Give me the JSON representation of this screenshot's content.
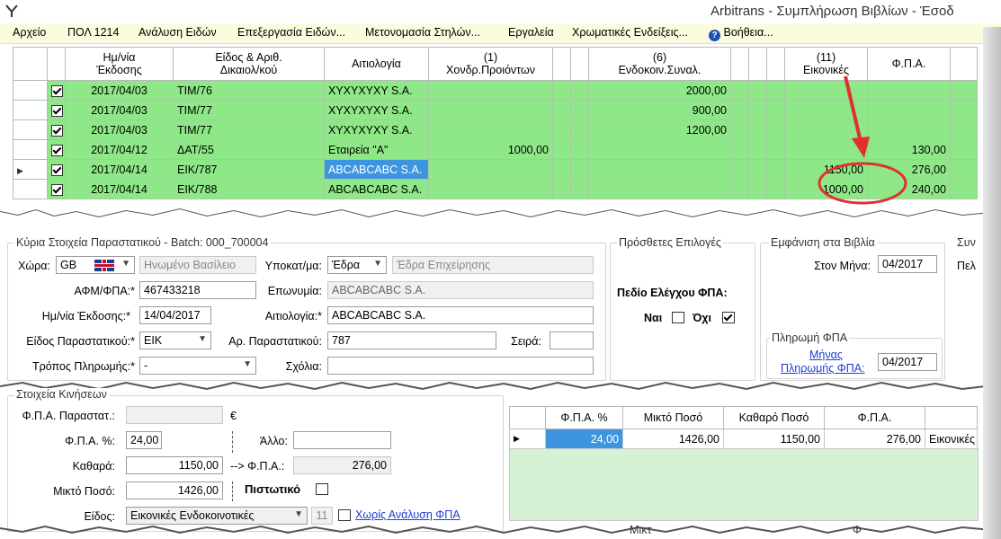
{
  "title": "Arbitrans - Συμπλήρωση Βιβλίων - Έσοδ",
  "menu": [
    "Αρχείο",
    "ΠΟΛ 1214",
    "Ανάλυση Ειδών",
    "Επεξεργασία Ειδών...",
    "Μετονομασία Στηλών...",
    "Εργαλεία",
    "Χρωματικές Ενδείξεις...",
    "Βοήθεια..."
  ],
  "grid": {
    "headers": {
      "date_1": "Ημ/νία",
      "date_2": "Έκδοσης",
      "doc_1": "Είδος & Αριθ.",
      "doc_2": "Δικαιολ/κού",
      "reason": "Αιτιολογία",
      "c1_1": "(1)",
      "c1_2": "Χονδρ.Προιόντων",
      "c6_1": "(6)",
      "c6_2": "Ενδοκοιν.Συναλ.",
      "c11_1": "(11)",
      "c11_2": "Εικονικές",
      "vat": "Φ.Π.Α."
    },
    "rows": [
      {
        "checked": true,
        "date": "2017/04/03",
        "doc": "ΤΙΜ/76",
        "reason": "ΧΥΧΥΧΥΧΥ S.A.",
        "c1": "",
        "c6": "2000,00",
        "c11": "",
        "vat": "",
        "current": false
      },
      {
        "checked": true,
        "date": "2017/04/03",
        "doc": "ΤΙΜ/77",
        "reason": "ΧΥΧΥΧΥΧΥ S.A.",
        "c1": "",
        "c6": "900,00",
        "c11": "",
        "vat": "",
        "current": false
      },
      {
        "checked": true,
        "date": "2017/04/03",
        "doc": "ΤΙΜ/77",
        "reason": "ΧΥΧΥΧΥΧΥ S.A.",
        "c1": "",
        "c6": "1200,00",
        "c11": "",
        "vat": "",
        "current": false
      },
      {
        "checked": true,
        "date": "2017/04/12",
        "doc": "ΔΑΤ/55",
        "reason": "Εταιρεία \"Α\"",
        "c1": "1000,00",
        "c6": "",
        "c11": "",
        "vat": "130,00",
        "current": false
      },
      {
        "checked": true,
        "date": "2017/04/14",
        "doc": "ΕΙΚ/787",
        "reason": "ABCABCABC S.A.",
        "c1": "",
        "c6": "",
        "c11": "1150,00",
        "vat": "276,00",
        "current": true
      },
      {
        "checked": true,
        "date": "2017/04/14",
        "doc": "ΕΙΚ/788",
        "reason": "ABCABCABC S.A.",
        "c1": "",
        "c6": "",
        "c11": "1000,00",
        "vat": "240,00",
        "current": false
      }
    ]
  },
  "main_section": {
    "title": "Κύρια Στοιχεία Παραστατικού - Batch: 000_700004",
    "country_label": "Χώρα:",
    "country_code": "GB",
    "country_name": "Ηνωμένο Βασίλειο",
    "branch_label": "Υποκατ/μα:",
    "branch_value": "Έδρα",
    "branch_name": "Έδρα Επιχείρησης",
    "afm_label": "ΑΦΜ/ΦΠΑ:*",
    "afm_value": "467433218",
    "name_label": "Επωνυμία:",
    "name_value": "ABCABCABC S.A.",
    "date_label": "Ημ/νία Έκδοσης:*",
    "date_value": "14/04/2017",
    "reason_label": "Αιτιολογία:*",
    "reason_value": "ABCABCABC S.A.",
    "doctype_label": "Είδος Παραστατικού:*",
    "doctype_value": "ΕΙΚ",
    "docnum_label": "Αρ. Παραστατικού:",
    "docnum_value": "787",
    "series_label": "Σειρά:",
    "series_value": "",
    "payment_label": "Τρόπος Πληρωμής:*",
    "payment_value": "-",
    "comments_label": "Σχόλια:",
    "comments_value": ""
  },
  "extra_options": {
    "title": "Πρόσθετες Επιλογές",
    "vat_check_label": "Πεδίο Ελέγχου ΦΠΑ:",
    "yes_label": "Ναι",
    "no_label": "Όχι",
    "yes_checked": false,
    "no_checked": true
  },
  "books_display": {
    "title": "Εμφάνιση στα Βιβλία",
    "month_label": "Στον Μήνα:",
    "month_value": "04/2017"
  },
  "vat_payment": {
    "title": "Πληρωμή ΦΠΑ",
    "link_1": "Μήνας",
    "link_2": "Πληρωμής ΦΠΑ:",
    "value": "04/2017"
  },
  "cut_texts": [
    "Συν",
    "Πελ"
  ],
  "movements": {
    "title": "Στοιχεία Κινήσεων",
    "doc_vat_label": "Φ.Π.Α. Παραστατ.:",
    "doc_vat_value": "",
    "currency": "€",
    "vat_pct_label": "Φ.Π.Α. %:",
    "vat_pct_value": "24,00",
    "other_label": "Άλλο:",
    "other_value": "",
    "net_label": "Καθαρά:",
    "net_value": "1150,00",
    "arrow_vat_label": "--> Φ.Π.Α.:",
    "arrow_vat_value": "276,00",
    "gross_label": "Μικτό Ποσό:",
    "gross_value": "1426,00",
    "credit_label": "Πιστωτικό",
    "type_label": "Είδος:",
    "type_value": "Εικονικές Ενδοκοινοτικές",
    "type_code": "11",
    "no_vat_link": "Χωρίς Ανάλυση ΦΠΑ"
  },
  "small_grid": {
    "headers": [
      "Φ.Π.Α. %",
      "Μικτό Ποσό",
      "Καθαρό Ποσό",
      "Φ.Π.Α.",
      ""
    ],
    "row": [
      "24,00",
      "1426,00",
      "1150,00",
      "276,00",
      "Εικονικές"
    ],
    "bottom_cut": [
      "Μικτ",
      "Φ"
    ]
  }
}
